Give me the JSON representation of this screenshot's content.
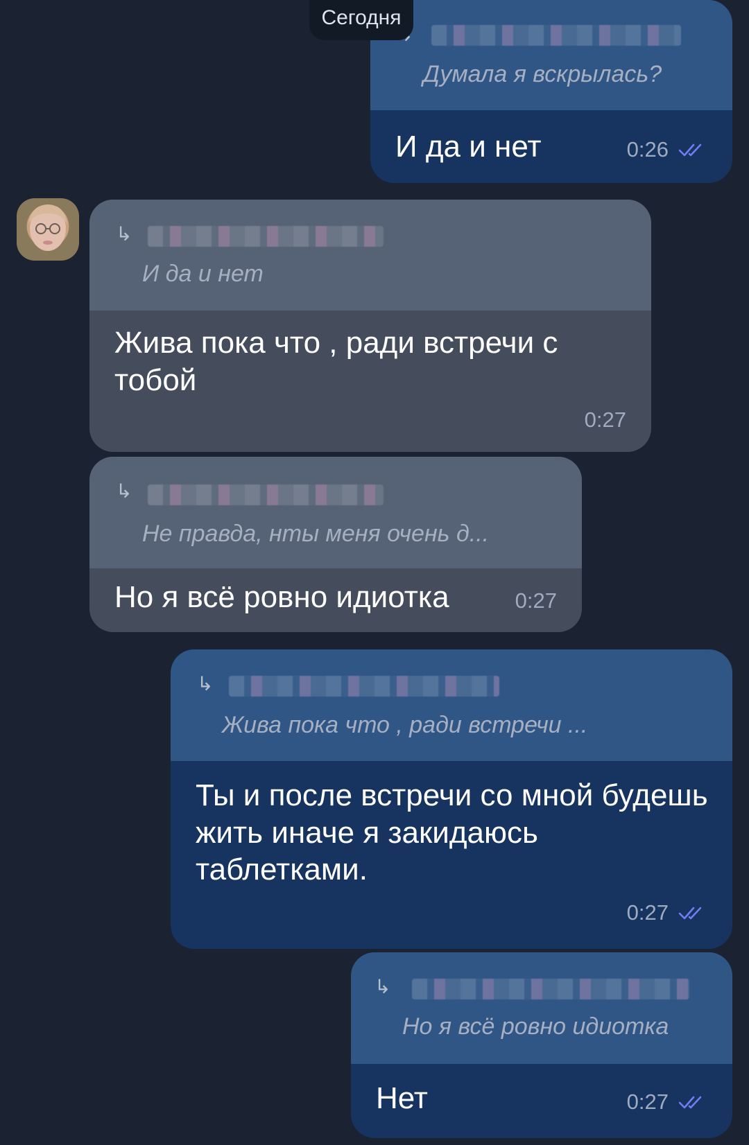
{
  "date_separator": "Сегодня",
  "messages": [
    {
      "direction": "out",
      "reply": {
        "text": "Думала я вскрылась?"
      },
      "text": "И да и нет",
      "time": "0:26",
      "read": true
    },
    {
      "direction": "in",
      "reply": {
        "text": "И да и нет"
      },
      "text": "Жива пока что , ради встречи с тобой",
      "time": "0:27"
    },
    {
      "direction": "in",
      "reply": {
        "text": "Не правда, нты меня очень д..."
      },
      "text": "Но я всё ровно идиотка",
      "time": "0:27"
    },
    {
      "direction": "out",
      "reply": {
        "text": "Жива пока что , ради встречи ..."
      },
      "text": "Ты и после встречи со мной будешь жить иначе я закидаюсь таблетками.",
      "time": "0:27",
      "read": true
    },
    {
      "direction": "out",
      "reply": {
        "text": "Но я всё ровно идиотка"
      },
      "text": "Нет",
      "time": "0:27",
      "read": true
    }
  ],
  "icons": {
    "reply": "reply-arrow-icon",
    "read": "double-check-icon",
    "avatar": "avatar"
  },
  "colors": {
    "background": "#1b2231",
    "outgoing_bubble": "#16345f",
    "outgoing_reply": "#2f5685",
    "incoming_bubble": "#454d5d",
    "incoming_reply": "#566276",
    "read_ticks": "#6f7ef2"
  }
}
